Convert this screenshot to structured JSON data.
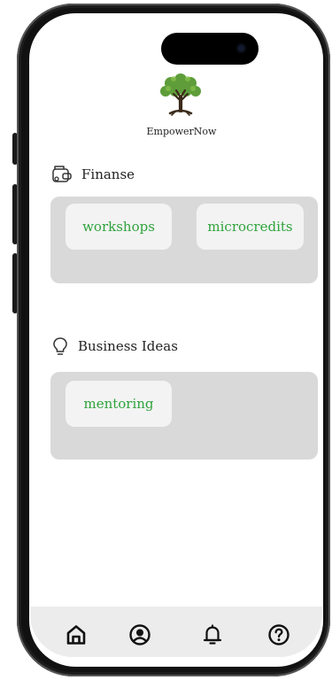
{
  "app": {
    "name": "EmpowerNow"
  },
  "sections": [
    {
      "title": "Finanse",
      "icon": "wallet-icon",
      "chips": [
        "workshops",
        "microcredits"
      ]
    },
    {
      "title": "Business Ideas",
      "icon": "lightbulb-icon",
      "chips": [
        "mentoring"
      ]
    }
  ],
  "nav": {
    "items": [
      {
        "icon": "home-icon"
      },
      {
        "icon": "user-circle-icon"
      },
      {
        "icon": "bell-icon"
      },
      {
        "icon": "help-icon"
      }
    ]
  },
  "colors": {
    "accent": "#2fa33b",
    "panel": "#d9d9d9",
    "chip": "#f3f3f3",
    "bottom_bar": "#ececec"
  }
}
